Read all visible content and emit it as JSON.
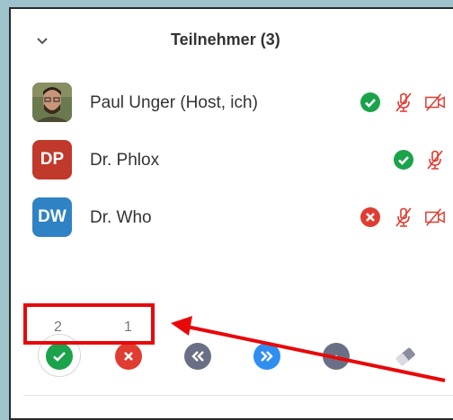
{
  "header": {
    "title": "Teilnehmer (3)"
  },
  "participants": [
    {
      "name": "Paul Unger (Host, ich)",
      "avatar": "",
      "avatar_color": "#5a6b3a"
    },
    {
      "name": "Dr. Phlox",
      "avatar": "DP",
      "avatar_color": "#c0392b"
    },
    {
      "name": "Dr. Who",
      "avatar": "DW",
      "avatar_color": "#2f83c4"
    }
  ],
  "reactions": {
    "yes_count": "2",
    "no_count": "1"
  },
  "colors": {
    "green": "#1aa34a",
    "red": "#e03c31",
    "blue": "#2f8ef0",
    "gray": "#6b6f85",
    "annotation": "#e8080a"
  }
}
